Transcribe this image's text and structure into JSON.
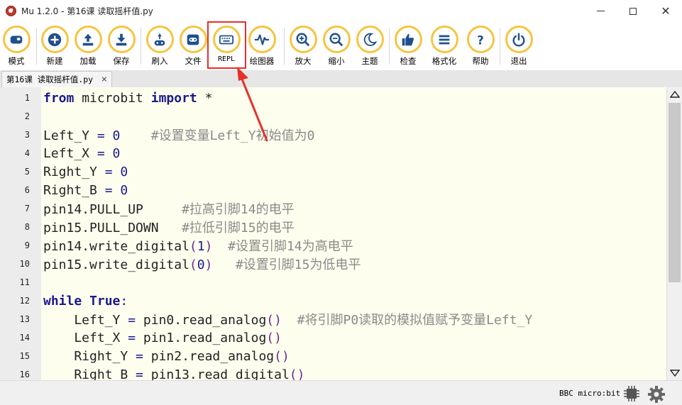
{
  "window": {
    "title": "Mu 1.2.0 - 第16课 读取摇杆值.py"
  },
  "toolbar": {
    "buttons": [
      {
        "label": "模式",
        "icon": "mode-icon"
      },
      {
        "label": "新建",
        "icon": "plus-icon"
      },
      {
        "label": "加载",
        "icon": "upload-icon"
      },
      {
        "label": "保存",
        "icon": "download-icon"
      },
      {
        "label": "刷入",
        "icon": "flash-icon"
      },
      {
        "label": "文件",
        "icon": "files-icon"
      },
      {
        "label": "REPL",
        "icon": "keyboard-icon"
      },
      {
        "label": "绘图器",
        "icon": "plotter-icon"
      },
      {
        "label": "放大",
        "icon": "zoom-in-icon"
      },
      {
        "label": "缩小",
        "icon": "zoom-out-icon"
      },
      {
        "label": "主题",
        "icon": "moon-icon"
      },
      {
        "label": "检查",
        "icon": "thumbs-up-icon"
      },
      {
        "label": "格式化",
        "icon": "tidy-icon"
      },
      {
        "label": "帮助",
        "icon": "question-icon"
      },
      {
        "label": "退出",
        "icon": "power-icon"
      }
    ],
    "accent_color": "#f5c542"
  },
  "tabs": [
    {
      "label": "第16课 读取摇杆值.py",
      "close": "×"
    }
  ],
  "editor": {
    "line_numbers": [
      "1",
      "2",
      "3",
      "4",
      "5",
      "6",
      "7",
      "8",
      "9",
      "10",
      "11",
      "12",
      "13",
      "14",
      "15",
      "16"
    ],
    "lines": [
      [
        {
          "t": "kw",
          "v": "from"
        },
        {
          "t": "tx",
          "v": " microbit "
        },
        {
          "t": "kw",
          "v": "import"
        },
        {
          "t": "tx",
          "v": " *"
        }
      ],
      [],
      [
        {
          "t": "tx",
          "v": "Left_Y "
        },
        {
          "t": "op",
          "v": "="
        },
        {
          "t": "tx",
          "v": " "
        },
        {
          "t": "num",
          "v": "0"
        },
        {
          "t": "tx",
          "v": "    "
        },
        {
          "t": "cm",
          "v": "#设置变量Left_Y初始值为0"
        }
      ],
      [
        {
          "t": "tx",
          "v": "Left_X "
        },
        {
          "t": "op",
          "v": "="
        },
        {
          "t": "tx",
          "v": " "
        },
        {
          "t": "num",
          "v": "0"
        }
      ],
      [
        {
          "t": "tx",
          "v": "Right_Y "
        },
        {
          "t": "op",
          "v": "="
        },
        {
          "t": "tx",
          "v": " "
        },
        {
          "t": "num",
          "v": "0"
        }
      ],
      [
        {
          "t": "tx",
          "v": "Right_B "
        },
        {
          "t": "op",
          "v": "="
        },
        {
          "t": "tx",
          "v": " "
        },
        {
          "t": "num",
          "v": "0"
        }
      ],
      [
        {
          "t": "tx",
          "v": "pin14.PULL_UP     "
        },
        {
          "t": "cm",
          "v": "#拉高引脚14的电平"
        }
      ],
      [
        {
          "t": "tx",
          "v": "pin15.PULL_DOWN   "
        },
        {
          "t": "cm",
          "v": "#拉低引脚15的电平"
        }
      ],
      [
        {
          "t": "tx",
          "v": "pin14.write_digital"
        },
        {
          "t": "par",
          "v": "("
        },
        {
          "t": "num",
          "v": "1"
        },
        {
          "t": "par",
          "v": ")"
        },
        {
          "t": "tx",
          "v": "  "
        },
        {
          "t": "cm",
          "v": "#设置引脚14为高电平"
        }
      ],
      [
        {
          "t": "tx",
          "v": "pin15.write_digital"
        },
        {
          "t": "par",
          "v": "("
        },
        {
          "t": "num",
          "v": "0"
        },
        {
          "t": "par",
          "v": ")"
        },
        {
          "t": "tx",
          "v": "   "
        },
        {
          "t": "cm",
          "v": "#设置引脚15为低电平"
        }
      ],
      [],
      [
        {
          "t": "kw",
          "v": "while"
        },
        {
          "t": "tx",
          "v": " "
        },
        {
          "t": "kw",
          "v": "True"
        },
        {
          "t": "op",
          "v": ":"
        }
      ],
      [
        {
          "t": "tx",
          "v": "    Left_Y "
        },
        {
          "t": "op",
          "v": "="
        },
        {
          "t": "tx",
          "v": " pin0.read_analog"
        },
        {
          "t": "par",
          "v": "()"
        },
        {
          "t": "tx",
          "v": "  "
        },
        {
          "t": "cm",
          "v": "#将引脚P0读取的模拟值赋予变量Left_Y"
        }
      ],
      [
        {
          "t": "tx",
          "v": "    Left_X "
        },
        {
          "t": "op",
          "v": "="
        },
        {
          "t": "tx",
          "v": " pin1.read_analog"
        },
        {
          "t": "par",
          "v": "()"
        }
      ],
      [
        {
          "t": "tx",
          "v": "    Right_Y "
        },
        {
          "t": "op",
          "v": "="
        },
        {
          "t": "tx",
          "v": " pin2.read_analog"
        },
        {
          "t": "par",
          "v": "()"
        }
      ],
      [
        {
          "t": "tx",
          "v": "    Right_B "
        },
        {
          "t": "op",
          "v": "="
        },
        {
          "t": "tx",
          "v": " pin13.read_digital"
        },
        {
          "t": "par",
          "v": "()"
        }
      ]
    ]
  },
  "statusbar": {
    "mode": "BBC micro:bit"
  },
  "annotation": {
    "color": "#e5302b"
  }
}
